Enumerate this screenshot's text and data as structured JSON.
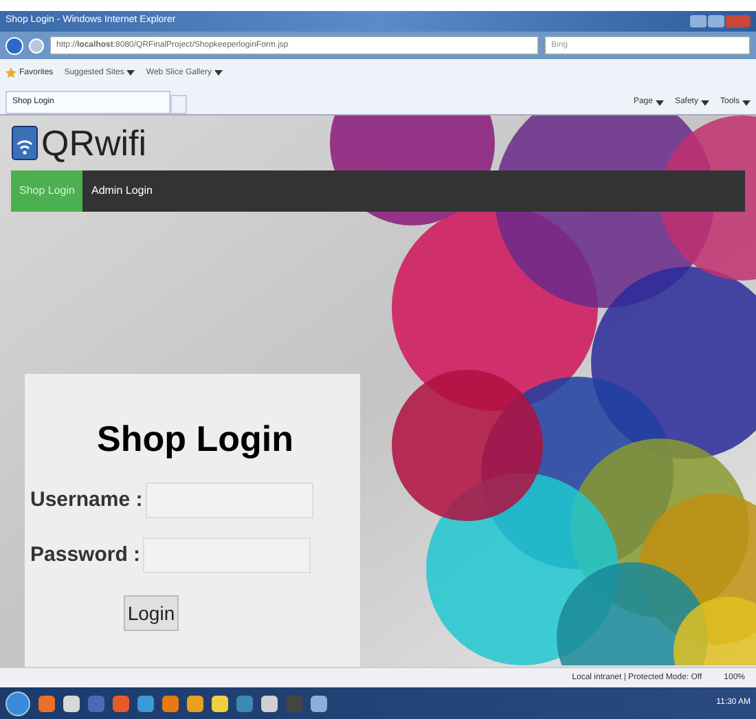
{
  "window": {
    "title": "Shop Login - Windows Internet Explorer"
  },
  "address_bar": {
    "url": "http://**localhost**:8080/QRFinalProject/ShopkeeperloginForm.jsp",
    "search_placeholder": "Bing"
  },
  "favorites_bar": {
    "label": "Favorites",
    "items": [
      "Suggested Sites",
      "Web Slice Gallery"
    ]
  },
  "tab": {
    "label": "Shop Login"
  },
  "command_bar": [
    "Page",
    "Safety",
    "Tools"
  ],
  "site": {
    "logo": "QRwifi",
    "nav": [
      {
        "label": "Shop Login",
        "selected": true
      },
      {
        "label": "Admin Login",
        "selected": false
      }
    ]
  },
  "login": {
    "title": "Shop Login",
    "fields": [
      {
        "label": "Username :"
      },
      {
        "label": "Password :"
      }
    ],
    "button": "Login"
  },
  "status_bar": {
    "zone": "Local intranet | Protected Mode: Off",
    "zoom": "100%"
  },
  "taskbar": {
    "clock": "11:30 AM"
  }
}
